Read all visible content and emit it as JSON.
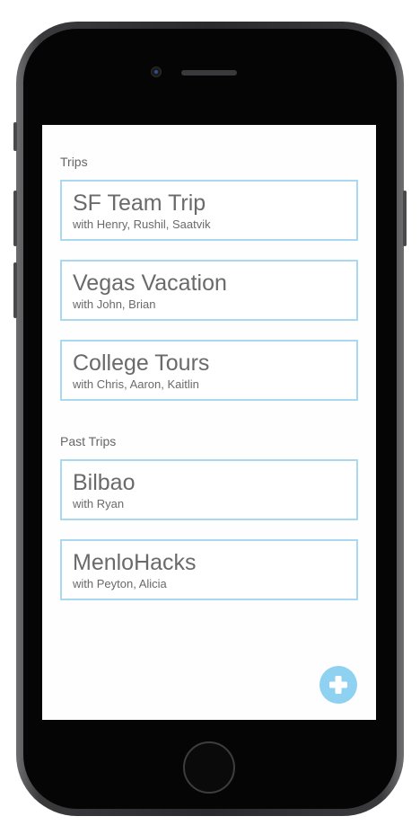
{
  "trips_section": {
    "label": "Trips",
    "items": [
      {
        "title": "SF Team Trip",
        "subtitle": "with Henry, Rushil, Saatvik"
      },
      {
        "title": "Vegas Vacation",
        "subtitle": "with John, Brian"
      },
      {
        "title": "College Tours",
        "subtitle": "with Chris, Aaron, Kaitlin"
      }
    ]
  },
  "past_trips_section": {
    "label": "Past Trips",
    "items": [
      {
        "title": "Bilbao",
        "subtitle": "with Ryan"
      },
      {
        "title": "MenloHacks",
        "subtitle": "with Peyton, Alicia"
      }
    ]
  },
  "add_button": {
    "icon": "plus-icon"
  },
  "colors": {
    "card_border": "#a9d9ef",
    "accent": "#8fd1f0",
    "text": "#6a6a6a"
  }
}
